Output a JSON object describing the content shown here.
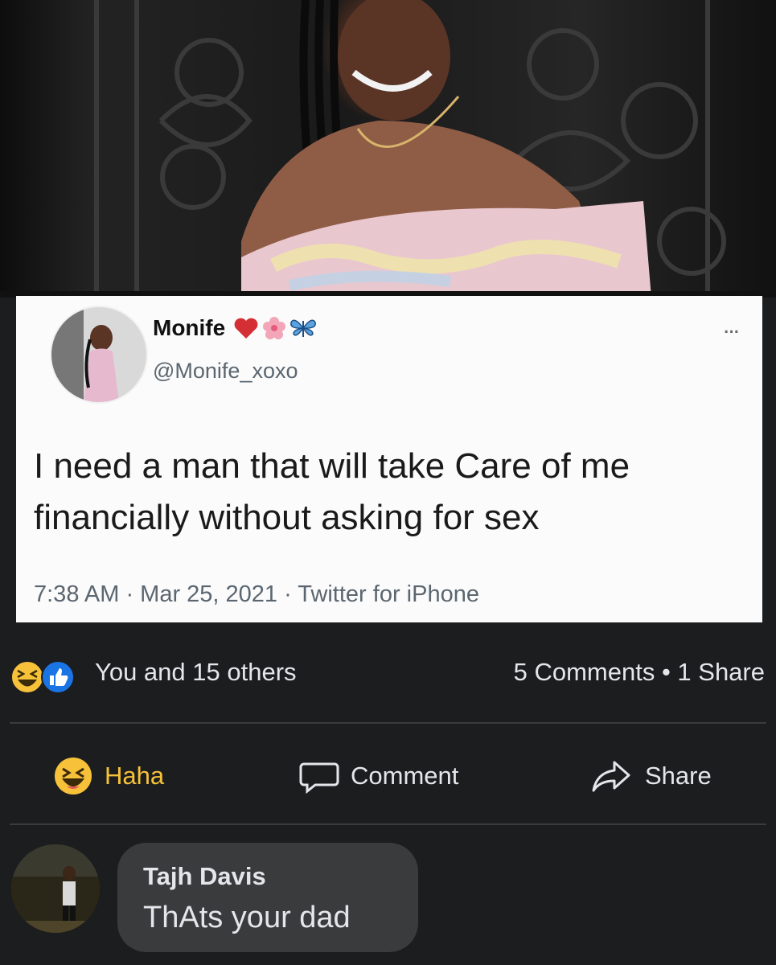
{
  "tweet": {
    "name": "Monife",
    "name_emojis": [
      "red-heart-icon",
      "flower-icon",
      "butterfly-icon"
    ],
    "handle": "@Monife_xoxo",
    "text": "I need a man that will take Care of me financially without asking for sex",
    "meta": "7:38 AM · Mar 25, 2021 · Twitter for iPhone",
    "more": "..."
  },
  "post_stats": {
    "reactions": [
      "haha-icon",
      "like-icon"
    ],
    "likes_text": "You and 15 others",
    "counts_text": "5 Comments • 1 Share"
  },
  "actions": {
    "haha": "Haha",
    "comment": "Comment",
    "share": "Share"
  },
  "comment": {
    "author": "Tajh Davis",
    "text": "ThAts your dad"
  },
  "colors": {
    "fb_background": "#1c1d1e",
    "fb_text": "#e4e6eb",
    "bubble": "#3a3b3c",
    "haha_yellow": "#f7c23a",
    "like_blue": "#1b74e4"
  }
}
